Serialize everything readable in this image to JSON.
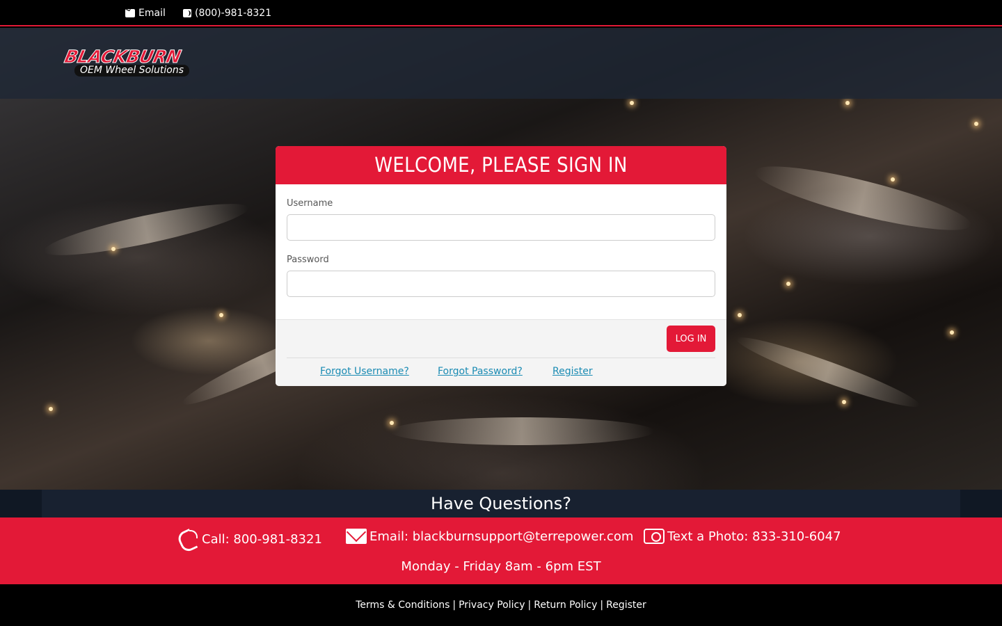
{
  "topbar": {
    "email_label": "Email",
    "phone_label": "(800)-981-8321"
  },
  "logo": {
    "brand": "BLACKBURN",
    "tagline": "OEM Wheel Solutions"
  },
  "login": {
    "title": "WELCOME, PLEASE SIGN IN",
    "username_label": "Username",
    "username_value": "",
    "password_label": "Password",
    "password_value": "",
    "submit_label": "LOG IN",
    "links": [
      "Forgot Username?",
      "Forgot Password?",
      "Register"
    ]
  },
  "questions": {
    "heading": "Have Questions?",
    "call": "Call: 800-981-8321",
    "email": "Email: blackburnsupport@terrepower.com",
    "text": "Text a Photo: 833-310-6047",
    "hours": "Monday - Friday 8am - 6pm EST"
  },
  "footer": {
    "links": [
      "Terms & Conditions",
      "Privacy Policy",
      "Return Policy",
      "Register"
    ],
    "separator": "|"
  },
  "colors": {
    "accent": "#e31937",
    "link": "#1a8bb3",
    "band": "#182130"
  }
}
